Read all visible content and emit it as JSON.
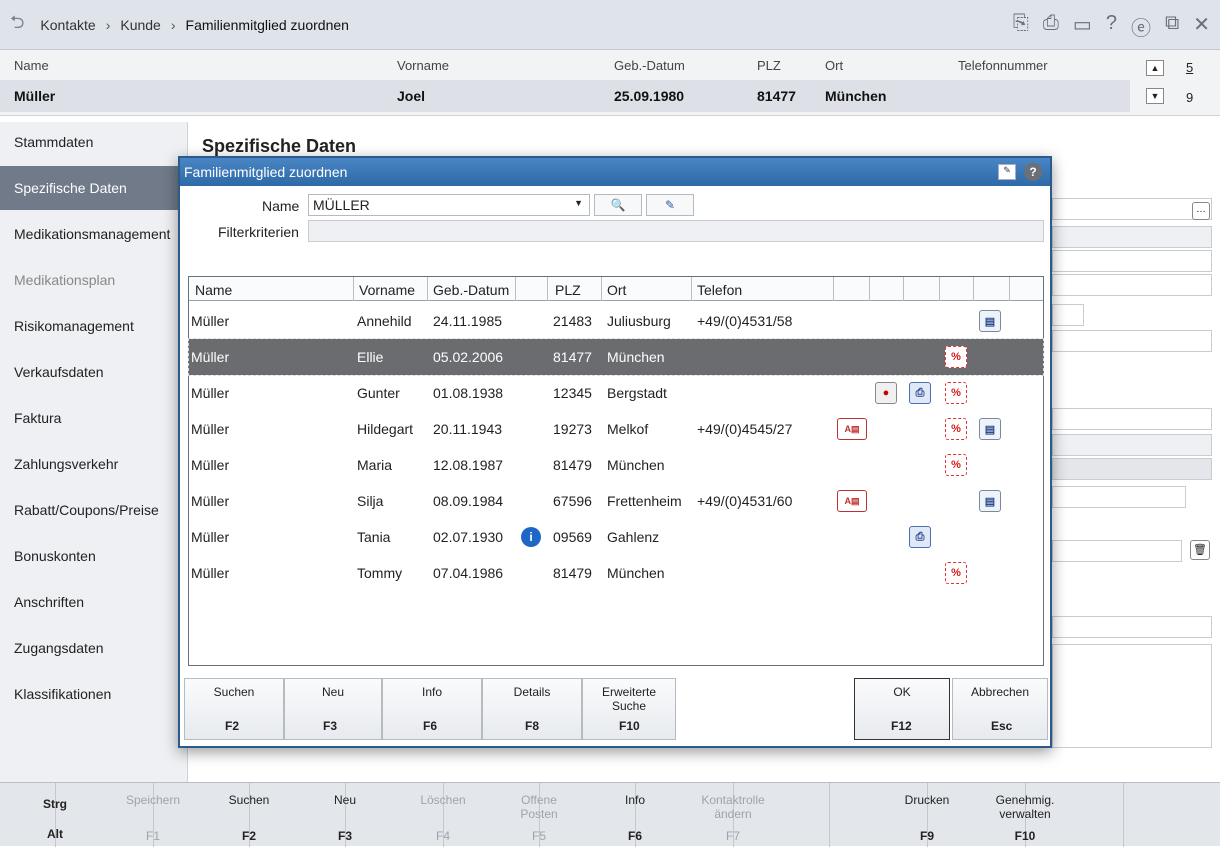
{
  "breadcrumb": [
    "Kontakte",
    "Kunde",
    "Familienmitglied zuordnen"
  ],
  "header": {
    "cols": [
      "Name",
      "Vorname",
      "Geb.-Datum",
      "PLZ",
      "Ort",
      "Telefonnummer"
    ],
    "values": {
      "name": "Müller",
      "vorname": "Joel",
      "geb": "25.09.1980",
      "plz": "81477",
      "ort": "München",
      "tel": ""
    },
    "page_top": "5",
    "page_bottom": "9"
  },
  "sidebar": [
    "Stammdaten",
    "Spezifische Daten",
    "Medikationsmanagement",
    "Medikationsplan",
    "Risikomanagement",
    "Verkaufsdaten",
    "Faktura",
    "Zahlungsverkehr",
    "Rabatt/Coupons/Preise",
    "Bonuskonten",
    "Anschriften",
    "Zugangsdaten",
    "Klassifikationen"
  ],
  "main_title": "Spezifische Daten",
  "dialog": {
    "title": "Familienmitglied zuordnen",
    "name_label": "Name",
    "name_value": "MÜLLER",
    "filter_label": "Filterkriterien",
    "columns": [
      "Name",
      "Vorname",
      "Geb.-Datum",
      "PLZ",
      "Ort",
      "Telefon"
    ],
    "rows": [
      {
        "name": "Müller",
        "vorname": "Annehild",
        "geb": "24.11.1985",
        "plz": "21483",
        "ort": "Juliusburg",
        "tel": "+49/(0)4531/58"
      },
      {
        "name": "Müller",
        "vorname": "Ellie",
        "geb": "05.02.2006",
        "plz": "81477",
        "ort": "München",
        "tel": ""
      },
      {
        "name": "Müller",
        "vorname": "Gunter",
        "geb": "01.08.1938",
        "plz": "12345",
        "ort": "Bergstadt",
        "tel": ""
      },
      {
        "name": "Müller",
        "vorname": "Hildegart",
        "geb": "20.11.1943",
        "plz": "19273",
        "ort": "Melkof",
        "tel": "+49/(0)4545/27"
      },
      {
        "name": "Müller",
        "vorname": "Maria",
        "geb": "12.08.1987",
        "plz": "81479",
        "ort": "München",
        "tel": ""
      },
      {
        "name": "Müller",
        "vorname": "Silja",
        "geb": "08.09.1984",
        "plz": "67596",
        "ort": "Frettenheim",
        "tel": "+49/(0)4531/60"
      },
      {
        "name": "Müller",
        "vorname": "Tania",
        "geb": "02.07.1930",
        "plz": "09569",
        "ort": "Gahlenz",
        "tel": ""
      },
      {
        "name": "Müller",
        "vorname": "Tommy",
        "geb": "07.04.1986",
        "plz": "81479",
        "ort": "München",
        "tel": ""
      }
    ],
    "buttons": [
      {
        "label": "Suchen",
        "key": "F2"
      },
      {
        "label": "Neu",
        "key": "F3"
      },
      {
        "label": "Info",
        "key": "F6"
      },
      {
        "label": "Details",
        "key": "F8"
      },
      {
        "label": "Erweiterte Suche",
        "key": "F10"
      },
      {
        "label": "OK",
        "key": "F12"
      },
      {
        "label": "Abbrechen",
        "key": "Esc"
      }
    ]
  },
  "fkeys": {
    "mod1": "Strg",
    "mod2": "Alt",
    "keys": [
      {
        "label": "Speichern",
        "key": "F1"
      },
      {
        "label": "Suchen",
        "key": "F2"
      },
      {
        "label": "Neu",
        "key": "F3"
      },
      {
        "label": "Löschen",
        "key": "F4"
      },
      {
        "label": "Offene Posten",
        "key": "F5"
      },
      {
        "label": "Info",
        "key": "F6"
      },
      {
        "label": "Kontaktrolle ändern",
        "key": "F7"
      },
      {
        "label": "",
        "key": ""
      },
      {
        "label": "Drucken",
        "key": "F9"
      },
      {
        "label": "Genehmig. verwalten",
        "key": "F10"
      },
      {
        "label": "",
        "key": ""
      },
      {
        "label": "",
        "key": ""
      }
    ]
  }
}
